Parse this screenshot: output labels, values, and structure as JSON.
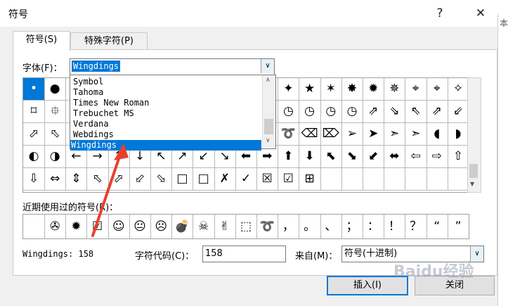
{
  "window": {
    "title": "符号",
    "help_label": "?",
    "close_label": "✕"
  },
  "background_text": "本",
  "tabs": [
    {
      "label": "符号(S)"
    },
    {
      "label": "特殊字符(P)"
    }
  ],
  "font": {
    "label": "字体(F)：",
    "value": "Wingdings",
    "dropdown_items": [
      "Symbol",
      "Tahoma",
      "Times New Roman",
      "Trebuchet MS",
      "Verdana",
      "Webdings",
      "Wingdings"
    ],
    "selected_index": 6
  },
  "grid_rows": [
    [
      "•",
      "●",
      "",
      "",
      "",
      "",
      "",
      "",
      "",
      "",
      "",
      "",
      "✦",
      "★",
      "✶",
      "✸",
      "✹",
      "✵",
      "⌖",
      "⌖",
      "✧"
    ],
    [
      "⌑",
      "⯐",
      "",
      "",
      "",
      "",
      "",
      "",
      "",
      "",
      "",
      "",
      "◷",
      "◷",
      "◷",
      "◷",
      "⇗",
      "⇘",
      "⇖",
      "⇗",
      "⇙"
    ],
    [
      "⬀",
      "⬁",
      "",
      "",
      "",
      "",
      "",
      "",
      "",
      "",
      "",
      "",
      "➰",
      "⌫",
      "⌦",
      "➢",
      "➤",
      "➣",
      "➣",
      "◖",
      "◗"
    ],
    [
      "◐",
      "◑",
      "←",
      "→",
      "↑",
      "↓",
      "↖",
      "↗",
      "↙",
      "↘",
      "⬅",
      "➡",
      "⬆",
      "⬇",
      "⬉",
      "⬊",
      "⬋",
      "⬌",
      "⇦",
      "⇨",
      "⇧"
    ],
    [
      "⇩",
      "⇔",
      "⇕",
      "⬁",
      "⬀",
      "⬃",
      "⬂",
      "□",
      "□",
      "✗",
      "✓",
      "☒",
      "☑",
      "⊞",
      "",
      "",
      "",
      "",
      "",
      "",
      ""
    ]
  ],
  "recent": {
    "label": "近期使用过的符号(R)：",
    "symbols": [
      "",
      "✇",
      "✹",
      "☑",
      "☺",
      "😐",
      "☹",
      "💣",
      "☠",
      "✌",
      "⬚",
      "➰",
      "，",
      "。",
      "、",
      "；",
      "：",
      "！",
      "？",
      "“",
      "”"
    ]
  },
  "char_name": "Wingdings: 158",
  "char_code": {
    "label": "字符代码(C)：",
    "value": "158"
  },
  "from": {
    "label": "来自(M)：",
    "value": "符号(十进制)"
  },
  "buttons": {
    "insert": "插入(I)",
    "close": "关闭"
  },
  "watermark": "Baidu经验",
  "colors": {
    "selection": "#0078d7",
    "arrow": "#e8402f"
  }
}
